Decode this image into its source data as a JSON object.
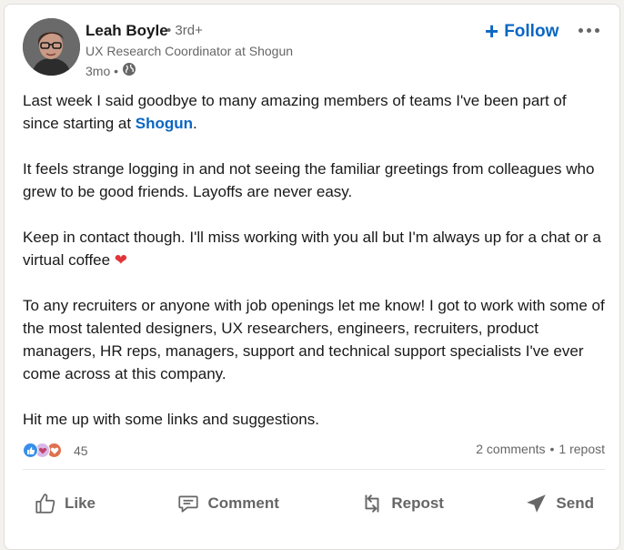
{
  "post": {
    "author": {
      "name": "Leah Boyle",
      "degree": "• 3rd+",
      "headline": "UX Research Coordinator at Shogun",
      "time": "3mo •",
      "visibility_icon": "globe-icon"
    },
    "follow_label": "Follow",
    "more_icon": "ellipsis-icon",
    "body": {
      "p1_text": "Last week I said goodbye to many amazing members of teams I've been part of since starting at ",
      "p1_mention": "Shogun",
      "p1_end": ".",
      "p2": "It feels strange logging in and not seeing the familiar greetings from colleagues who grew to be good friends. Layoffs are never easy.",
      "p3": "Keep in contact though. I'll miss working with you all but I'm always up for a chat or a virtual coffee ",
      "p3_emoji": "❤",
      "p4": "To any recruiters or anyone with job openings let me know! I got to work with some of the most talented designers, UX researchers, engineers, recruiters, product managers, HR reps, managers, support and technical support specialists I've ever come across at this company.",
      "p5": "Hit me up with some links and suggestions."
    },
    "social": {
      "reaction_icons": [
        "like-icon",
        "support-icon",
        "love-icon"
      ],
      "reaction_count": "45",
      "comments": "2 comments",
      "separator": "•",
      "reposts": "1 repost"
    },
    "actions": [
      {
        "label": "Like",
        "icon": "thumbs-up-icon"
      },
      {
        "label": "Comment",
        "icon": "comment-icon"
      },
      {
        "label": "Repost",
        "icon": "repost-icon"
      },
      {
        "label": "Send",
        "icon": "send-icon"
      }
    ],
    "colors": {
      "accent": "#0a66c2",
      "muted_text": "#666666",
      "heart": "#e0353b"
    }
  }
}
